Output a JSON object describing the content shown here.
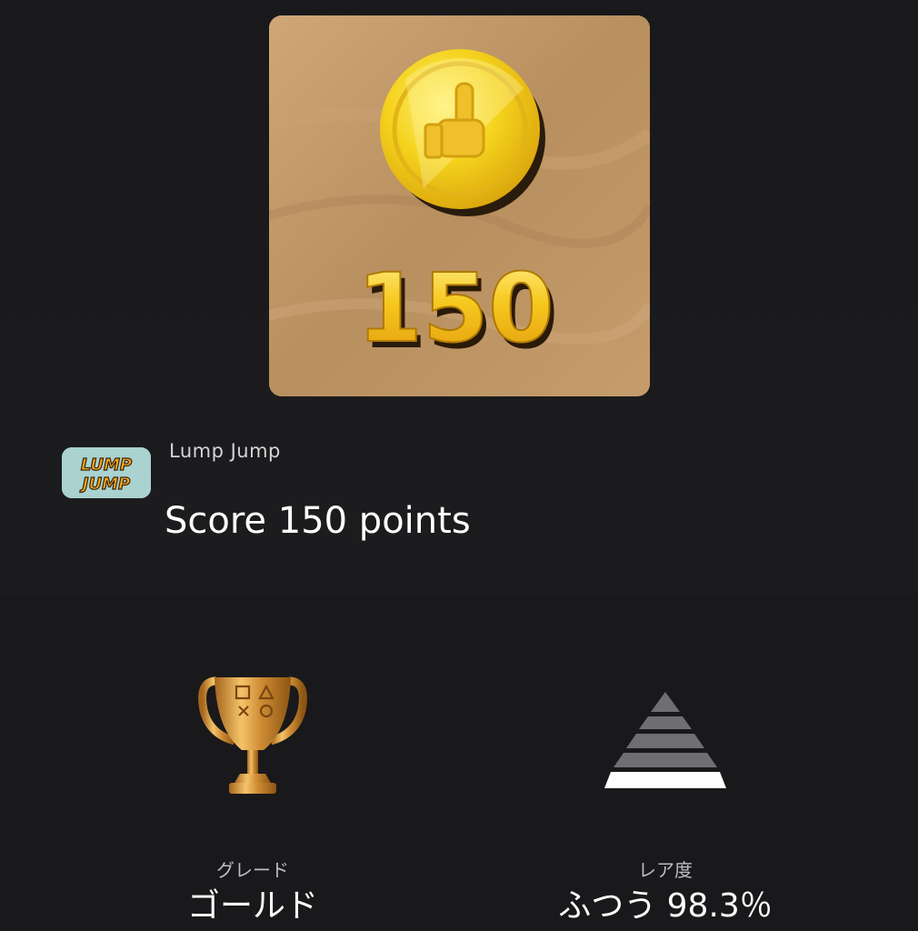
{
  "trophy": {
    "image_number": "150",
    "game_name": "Lump Jump",
    "game_icon_text": [
      "LUMP",
      "JUMP"
    ],
    "title": "Score 150 points"
  },
  "stats": {
    "grade": {
      "label": "グレード",
      "value": "ゴールド",
      "icon": "gold-trophy-icon"
    },
    "rarity": {
      "label": "レア度",
      "value": "ふつう 98.3％",
      "icon": "rarity-pyramid-icon",
      "percent": 98.3
    }
  },
  "colors": {
    "background": "#1b1b1d",
    "image_background": "#c29a6a",
    "gold": "#f2c12e",
    "pyramid_active": "#ffffff",
    "pyramid_inactive": "#6f6f71"
  }
}
